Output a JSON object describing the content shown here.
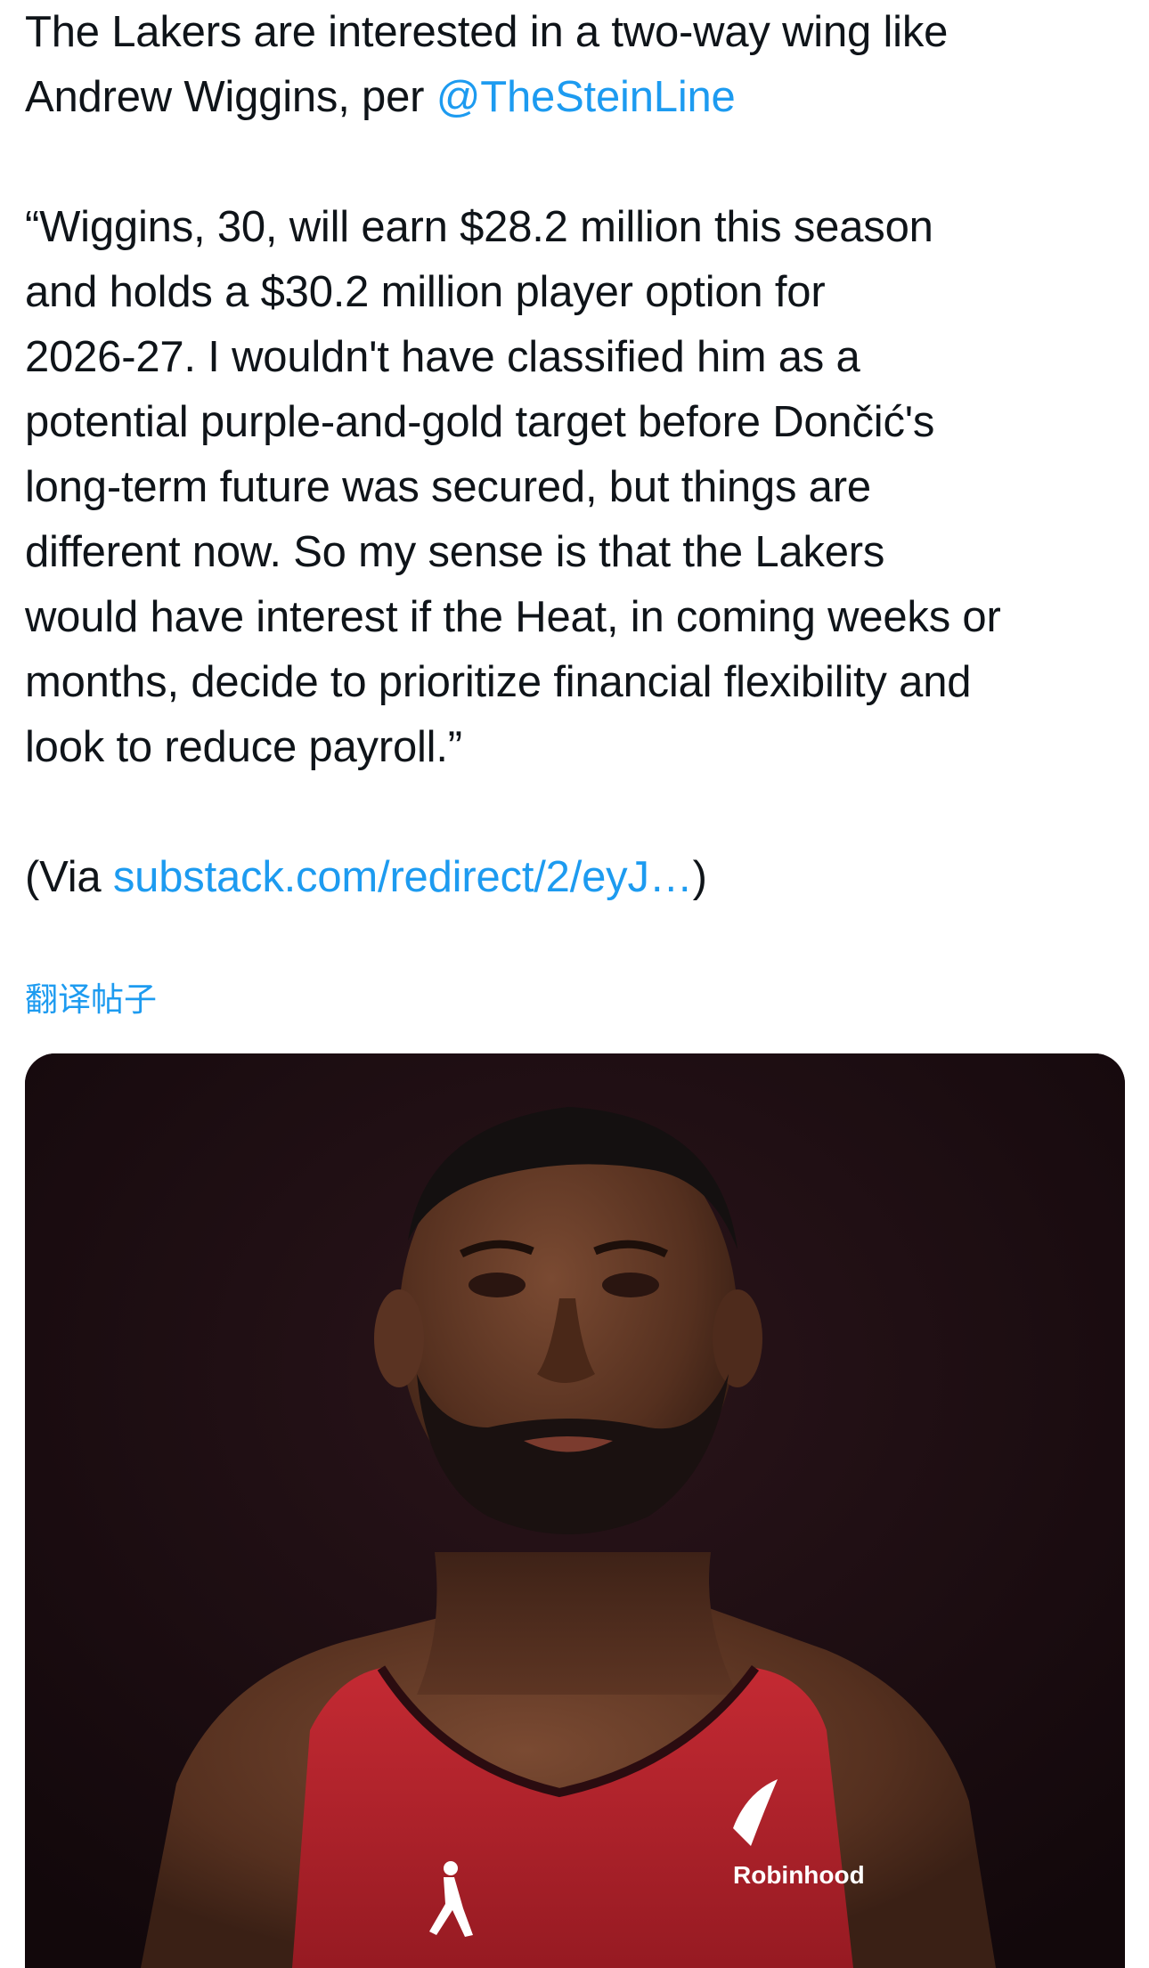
{
  "tweet": {
    "line1_prefix": "The Lakers are interested in a two-way wing like",
    "line2_prefix": "Andrew Wiggins, per ",
    "mention": "@TheSteinLine",
    "quote_lines": [
      "“Wiggins, 30, will earn $28.2 million this season",
      "and holds a $30.2 million player option for",
      "2026-27. I wouldn't have classified him as a",
      "potential purple-and-gold target before Dončić's",
      "long-term future was secured, but things are",
      "different now. So my sense is that the Lakers",
      "would have interest if the Heat, in coming weeks or",
      "months, decide to prioritize financial flexibility and",
      "look to reduce payroll.”"
    ],
    "via_prefix": "(Via ",
    "via_link": "substack.com/redirect/2/eyJ…",
    "via_suffix": ")"
  },
  "translate_label": "翻译帖子",
  "media": {
    "jersey_sponsor": "Robinhood",
    "colors": {
      "background": "#1b0d12",
      "jersey": "#b3222c",
      "skin": "#5a3322"
    }
  },
  "colors": {
    "text": "#0f1419",
    "link": "#1d9bf0"
  }
}
